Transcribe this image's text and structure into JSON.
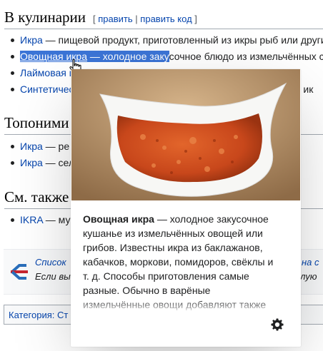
{
  "section1": {
    "title": "В кулинарии",
    "edit_open": "[",
    "edit_link": "править",
    "edit_sep": "|",
    "edit_code": "править код",
    "edit_close": "]"
  },
  "section1_items": [
    {
      "link": "Икра",
      "text": " — пищевой продукт, приготовленный из икры рыб или други"
    },
    {
      "sel_link": "Овощная икра",
      "sel_text": " — холодное заку",
      "text": "сочное блюдо из измельчённых с"
    },
    {
      "link": "Лаймовая и"
    },
    {
      "link": "Синтетичес",
      "text": "ю ик"
    }
  ],
  "section2": {
    "title": "Топоними"
  },
  "section2_items": [
    {
      "link": "Икра",
      "text": " — ре"
    },
    {
      "link": "Икра",
      "text": " — сел"
    }
  ],
  "section3": {
    "title": "См. также"
  },
  "section3_items": [
    {
      "link": "IKRA",
      "text": " — му"
    }
  ],
  "ambox": {
    "line1_prefix": "Список",
    "line1_suffix": "ки на с",
    "line2_prefix": "Если вы",
    "line2_suffix": "алую"
  },
  "category": {
    "label": "Категория:",
    "value": "Ст"
  },
  "popup": {
    "image_icon": "food-photo",
    "term": "Овощная икра",
    "extract": " — холодное закусочное кушанье из измельчённых овощей или грибов. Известны икра из баклажанов, кабачков, моркови, помидоров, свёклы и т. д. Способы приготовления самые разные. Обычно в варёные измельчённые овощи добавляют также измельчённы",
    "settings_icon": "gear-icon"
  },
  "colors": {
    "link": "#0645ad",
    "selection": "#3b74d6",
    "text": "#202122"
  }
}
